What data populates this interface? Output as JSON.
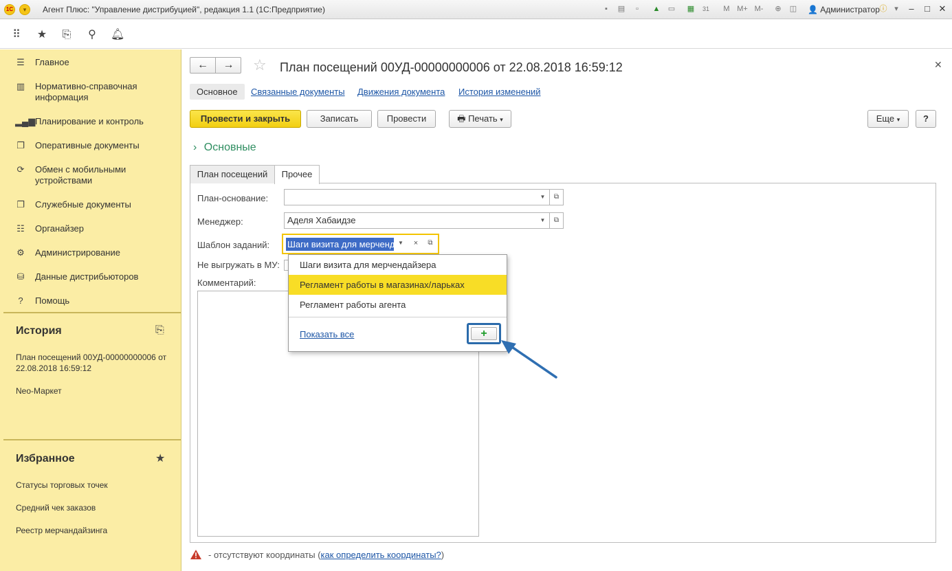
{
  "window": {
    "title": "Агент Плюс: \"Управление дистрибуцией\", редакция 1.1  (1С:Предприятие)",
    "user": "Администратор",
    "zoom_labels": [
      "M",
      "M+",
      "M-"
    ],
    "calendar_day": "31"
  },
  "sidebar": {
    "items": [
      {
        "label": "Главное",
        "icon": "menu-icon"
      },
      {
        "label": "Нормативно-справочная информация",
        "icon": "catalog-icon"
      },
      {
        "label": "Планирование и контроль",
        "icon": "chart-icon"
      },
      {
        "label": "Оперативные документы",
        "icon": "documents-icon"
      },
      {
        "label": "Обмен с мобильными устройствами",
        "icon": "sync-icon"
      },
      {
        "label": "Служебные документы",
        "icon": "service-docs-icon"
      },
      {
        "label": "Органайзер",
        "icon": "organizer-icon"
      },
      {
        "label": "Администрирование",
        "icon": "gear-icon"
      },
      {
        "label": "Данные дистрибьюторов",
        "icon": "database-icon"
      },
      {
        "label": "Помощь",
        "icon": "help-icon"
      }
    ],
    "history": {
      "title": "История",
      "entries": [
        "План посещений 00УД-00000000006 от 22.08.2018 16:59:12",
        "Neo-Маркет"
      ]
    },
    "favorites": {
      "title": "Избранное",
      "items": [
        "Статусы торговых точек",
        "Средний чек заказов",
        "Реестр мерчандайзинга"
      ]
    }
  },
  "document": {
    "title": "План посещений 00УД-00000000006 от 22.08.2018 16:59:12",
    "nav_tabs": [
      "Основное",
      "Связанные документы",
      "Движения документа",
      "История изменений"
    ],
    "buttons": {
      "post_close": "Провести и закрыть",
      "save": "Записать",
      "post": "Провести",
      "print": "Печать",
      "more": "Еще",
      "help": "?"
    },
    "group_title": "Основные",
    "form_tabs": [
      "План посещений",
      "Прочее"
    ],
    "fields": {
      "plan_base_label": "План-основание:",
      "plan_base_value": "",
      "manager_label": "Менеджер:",
      "manager_value": "Аделя Хабаидзе",
      "template_label": "Шаблон заданий:",
      "template_value": "Шаги визита для мерчендайзера",
      "no_export_label": "Не выгружать в МУ:",
      "comment_label": "Комментарий:"
    },
    "dropdown": {
      "options": [
        "Шаги визита для мерчендайзера",
        "Регламент работы в магазинах/ларьках",
        "Регламент работы агента"
      ],
      "highlighted_index": 1,
      "show_all": "Показать все",
      "add_symbol": "+"
    },
    "status": {
      "prefix": "- отсутствуют координаты (",
      "link": "как определить координаты?",
      "suffix": ")"
    }
  }
}
